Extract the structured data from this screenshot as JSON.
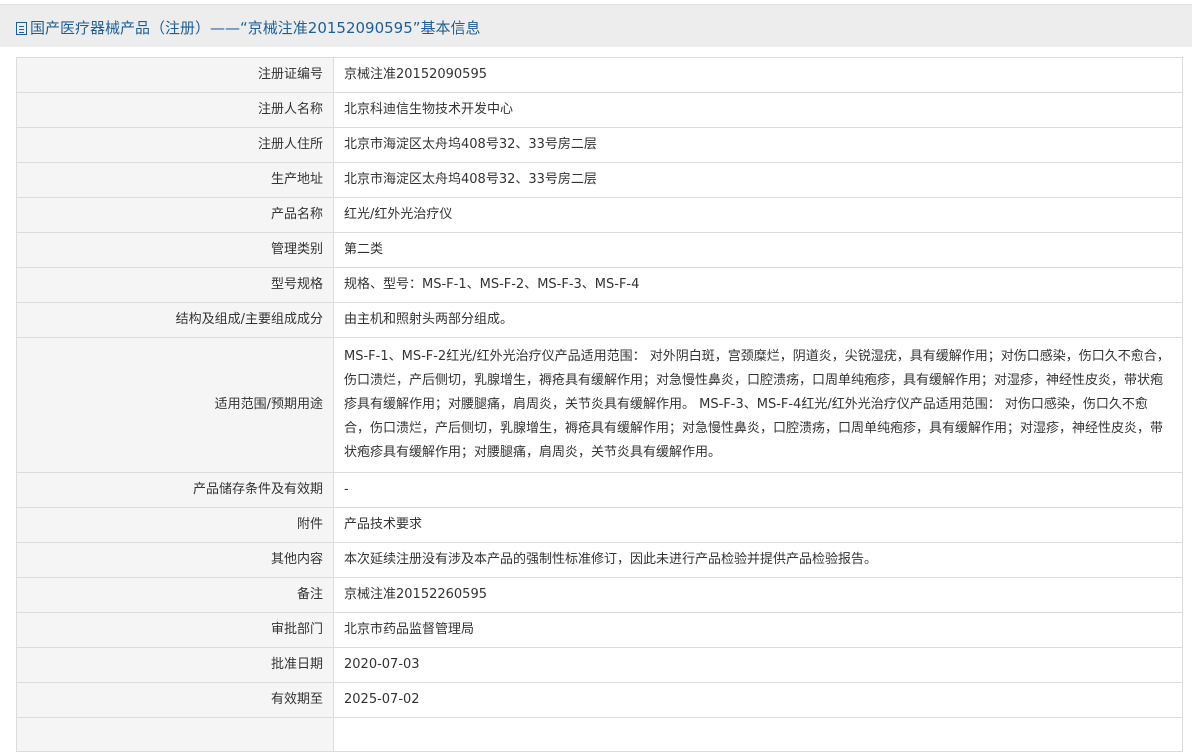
{
  "header": {
    "icon": "document-icon",
    "title": "国产医疗器械产品（注册）——“京械注准20152090595”基本信息"
  },
  "rows": [
    {
      "label": "注册证编号",
      "value": "京械注准20152090595"
    },
    {
      "label": "注册人名称",
      "value": "北京科迪信生物技术开发中心"
    },
    {
      "label": "注册人住所",
      "value": "北京市海淀区太舟坞408号32、33号房二层"
    },
    {
      "label": "生产地址",
      "value": "北京市海淀区太舟坞408号32、33号房二层"
    },
    {
      "label": "产品名称",
      "value": "红光/红外光治疗仪"
    },
    {
      "label": "管理类别",
      "value": "第二类"
    },
    {
      "label": "型号规格",
      "value": "规格、型号：MS-F-1、MS-F-2、MS-F-3、MS-F-4"
    },
    {
      "label": "结构及组成/主要组成成分",
      "value": "由主机和照射头两部分组成。"
    },
    {
      "label": "适用范围/预期用途",
      "value": "MS-F-1、MS-F-2红光/红外光治疗仪产品适用范围： 对外阴白斑，宫颈糜烂，阴道炎，尖锐湿疣，具有缓解作用；对伤口感染，伤口久不愈合，伤口溃烂，产后侧切，乳腺增生，褥疮具有缓解作用；对急慢性鼻炎，口腔溃疡，口周单纯疱疹，具有缓解作用；对湿疹，神经性皮炎，带状疱疹具有缓解作用；对腰腿痛，肩周炎，关节炎具有缓解作用。 MS-F-3、MS-F-4红光/红外光治疗仪产品适用范围： 对伤口感染，伤口久不愈合，伤口溃烂，产后侧切，乳腺增生，褥疮具有缓解作用；对急慢性鼻炎，口腔溃疡，口周单纯疱疹，具有缓解作用；对湿疹，神经性皮炎，带状疱疹具有缓解作用；对腰腿痛，肩周炎，关节炎具有缓解作用。"
    },
    {
      "label": "产品储存条件及有效期",
      "value": "-"
    },
    {
      "label": "附件",
      "value": "产品技术要求"
    },
    {
      "label": "其他内容",
      "value": "本次延续注册没有涉及本产品的强制性标准修订，因此未进行产品检验并提供产品检验报告。"
    },
    {
      "label": "备注",
      "value": "京械注准20152260595"
    },
    {
      "label": "审批部门",
      "value": "北京市药品监督管理局"
    },
    {
      "label": "批准日期",
      "value": "2020-07-03"
    },
    {
      "label": "有效期至",
      "value": "2025-07-02"
    },
    {
      "label": "",
      "value": ""
    }
  ]
}
